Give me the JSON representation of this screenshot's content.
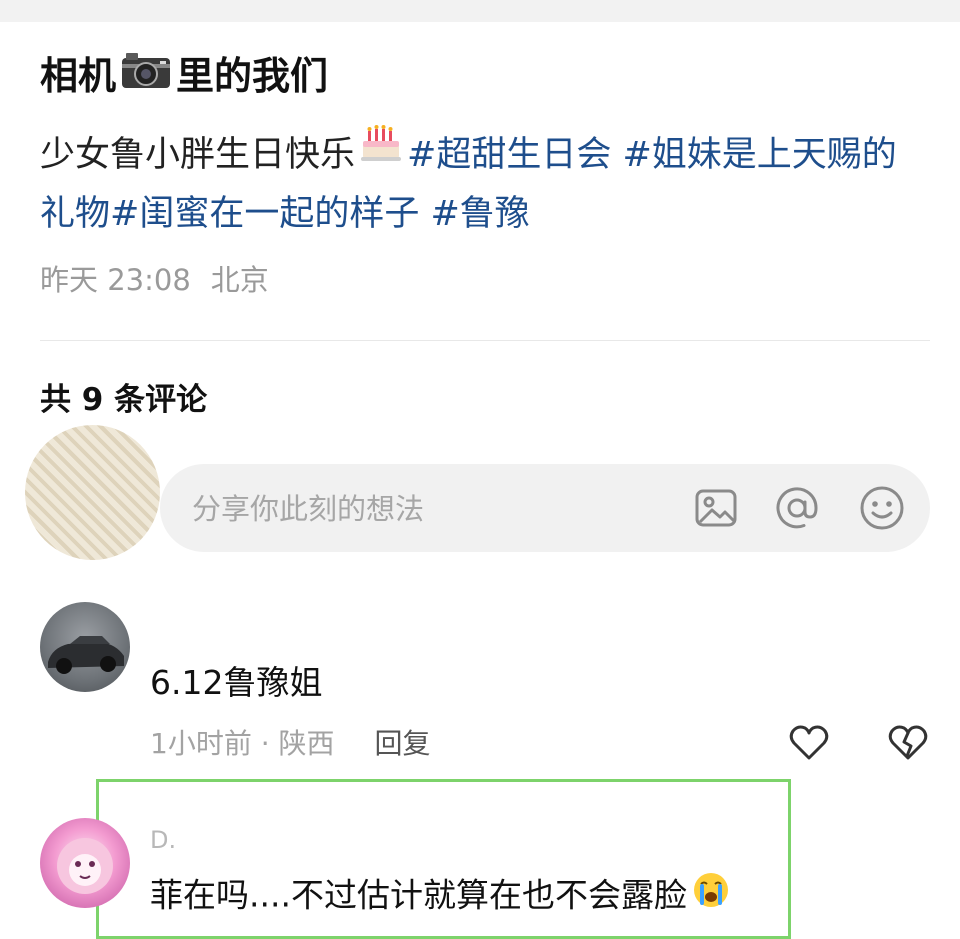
{
  "post": {
    "title_before": "相机",
    "title_after": "里的我们",
    "caption_text": "少女鲁小胖生日快乐",
    "tags": [
      "#超甜生日会",
      "#姐妹是上天赐的礼物",
      "#闺蜜在一起的样子",
      "#鲁豫"
    ],
    "time": "昨天 23:08",
    "location": "北京"
  },
  "comments_header": {
    "label": "共 9 条评论"
  },
  "composer": {
    "placeholder": "分享你此刻的想法",
    "icons": [
      "image-icon",
      "at-icon",
      "emoji-icon"
    ]
  },
  "comments": [
    {
      "username": "",
      "text": "6.12鲁豫姐",
      "time_location": "1小时前 · 陕西",
      "reply_label": "回复"
    },
    {
      "username": "D.",
      "text": "菲在吗....不过估计就算在也不会露脸"
    }
  ],
  "colors": {
    "tag": "#1e4e8c",
    "highlight": "#7dd36b",
    "muted": "#9a9a9a"
  }
}
